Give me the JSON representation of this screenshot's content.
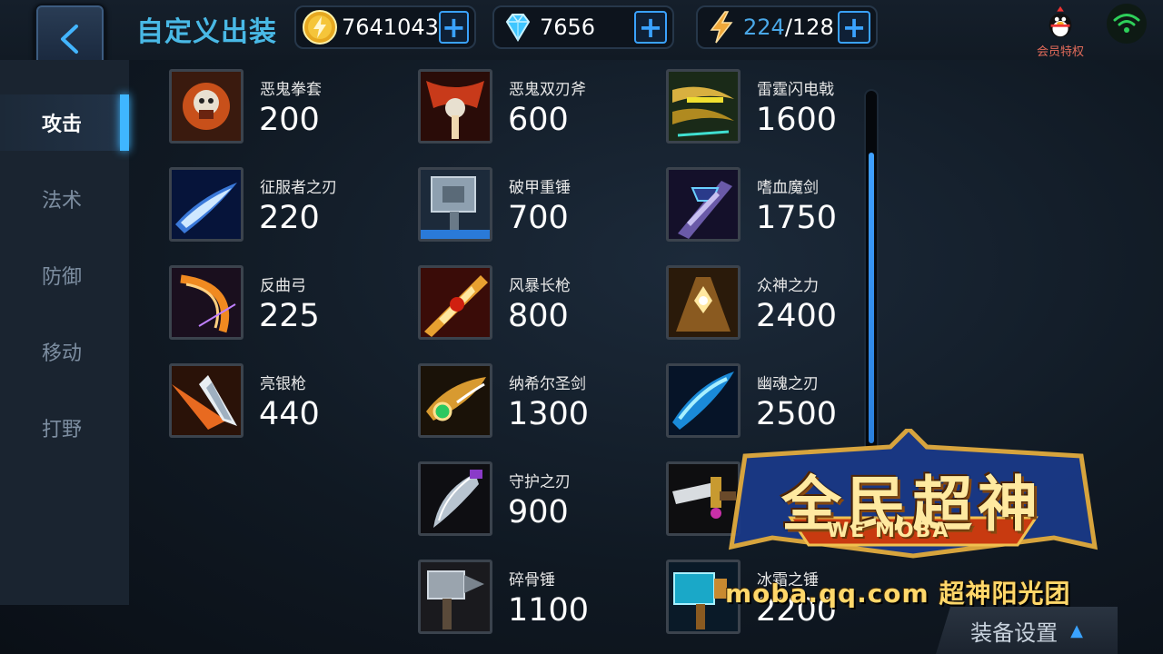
{
  "header": {
    "title": "自定义出装",
    "coins": "7641043",
    "diamonds": "7656",
    "energy_current": "224",
    "energy_max": "/128",
    "vip_label": "会员特权"
  },
  "sidebar": {
    "items": [
      {
        "label": "攻击",
        "active": true
      },
      {
        "label": "法术",
        "active": false
      },
      {
        "label": "防御",
        "active": false
      },
      {
        "label": "移动",
        "active": false
      },
      {
        "label": "打野",
        "active": false
      }
    ]
  },
  "items": {
    "col1": [
      {
        "name": "恶鬼拳套",
        "price": "200"
      },
      {
        "name": "征服者之刃",
        "price": "220"
      },
      {
        "name": "反曲弓",
        "price": "225"
      },
      {
        "name": "亮银枪",
        "price": "440"
      }
    ],
    "col2": [
      {
        "name": "恶鬼双刃斧",
        "price": "600"
      },
      {
        "name": "破甲重锤",
        "price": "700"
      },
      {
        "name": "风暴长枪",
        "price": "800"
      },
      {
        "name": "纳希尔圣剑",
        "price": "1300"
      },
      {
        "name": "守护之刃",
        "price": "900"
      },
      {
        "name": "碎骨锤",
        "price": "1100"
      }
    ],
    "col3": [
      {
        "name": "雷霆闪电戟",
        "price": "1600"
      },
      {
        "name": "嗜血魔剑",
        "price": "1750"
      },
      {
        "name": "众神之力",
        "price": "2400"
      },
      {
        "name": "幽魂之刃",
        "price": "2500"
      },
      {
        "name": "",
        "price": ""
      },
      {
        "name": "冰霜之锤",
        "price": "2200"
      }
    ]
  },
  "watermark": {
    "title": "全民超神",
    "subtitle": "WE MOBA",
    "url_text": "moba.qq.com  超神阳光团"
  },
  "footer": {
    "settings_label": "装备设置"
  },
  "colors": {
    "accent": "#3fb6ff",
    "title": "#49b9e6",
    "energy": "#4aa8e8"
  }
}
